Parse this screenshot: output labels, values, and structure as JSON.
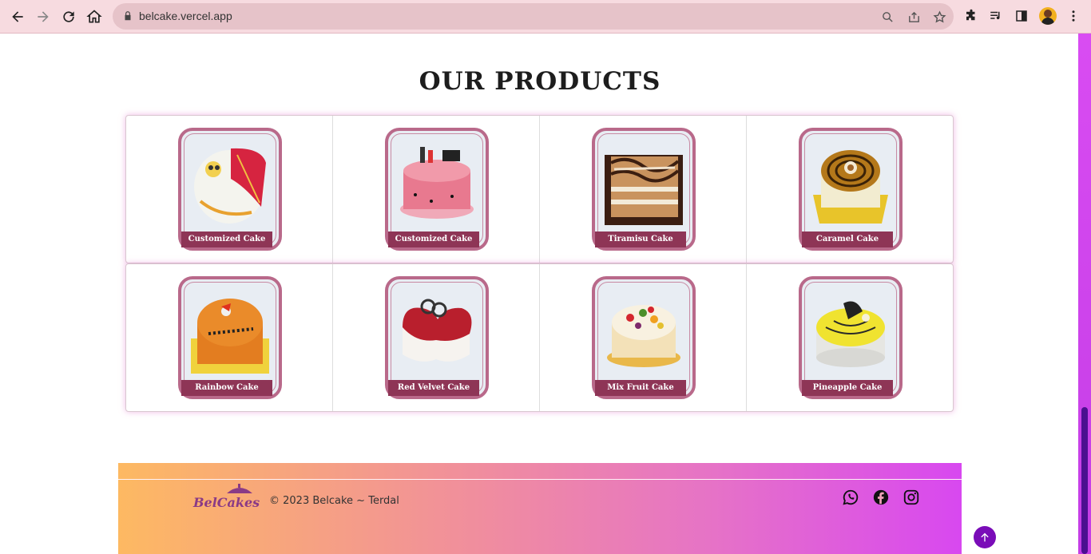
{
  "browser": {
    "url": "belcake.vercel.app",
    "icons": [
      "back-icon",
      "forward-icon",
      "reload-icon",
      "home-icon",
      "lock-icon",
      "zoom-icon",
      "share-icon",
      "bookmark-star-icon",
      "extensions-icon",
      "media-icon",
      "side-panel-icon",
      "profile-avatar",
      "more-icon"
    ]
  },
  "page": {
    "title": "OUR PRODUCTS"
  },
  "products": [
    {
      "label": "Customized Cake"
    },
    {
      "label": "Customized Cake"
    },
    {
      "label": "Tiramisu Cake"
    },
    {
      "label": "Caramel Cake"
    },
    {
      "label": "Rainbow Cake"
    },
    {
      "label": "Red Velvet Cake"
    },
    {
      "label": "Mix Fruit Cake"
    },
    {
      "label": "Pineapple Cake"
    }
  ],
  "footer": {
    "logo_text": "BelCakes",
    "copyright": "© 2023 Belcake ~ Terdal",
    "social": [
      "whatsapp-icon",
      "facebook-icon",
      "instagram-icon"
    ]
  },
  "colors": {
    "accent": "#8e3556",
    "scroll_top_button": "#7a0cb8",
    "footer_gradient_start": "#fdb962",
    "footer_gradient_end": "#d848f0"
  }
}
